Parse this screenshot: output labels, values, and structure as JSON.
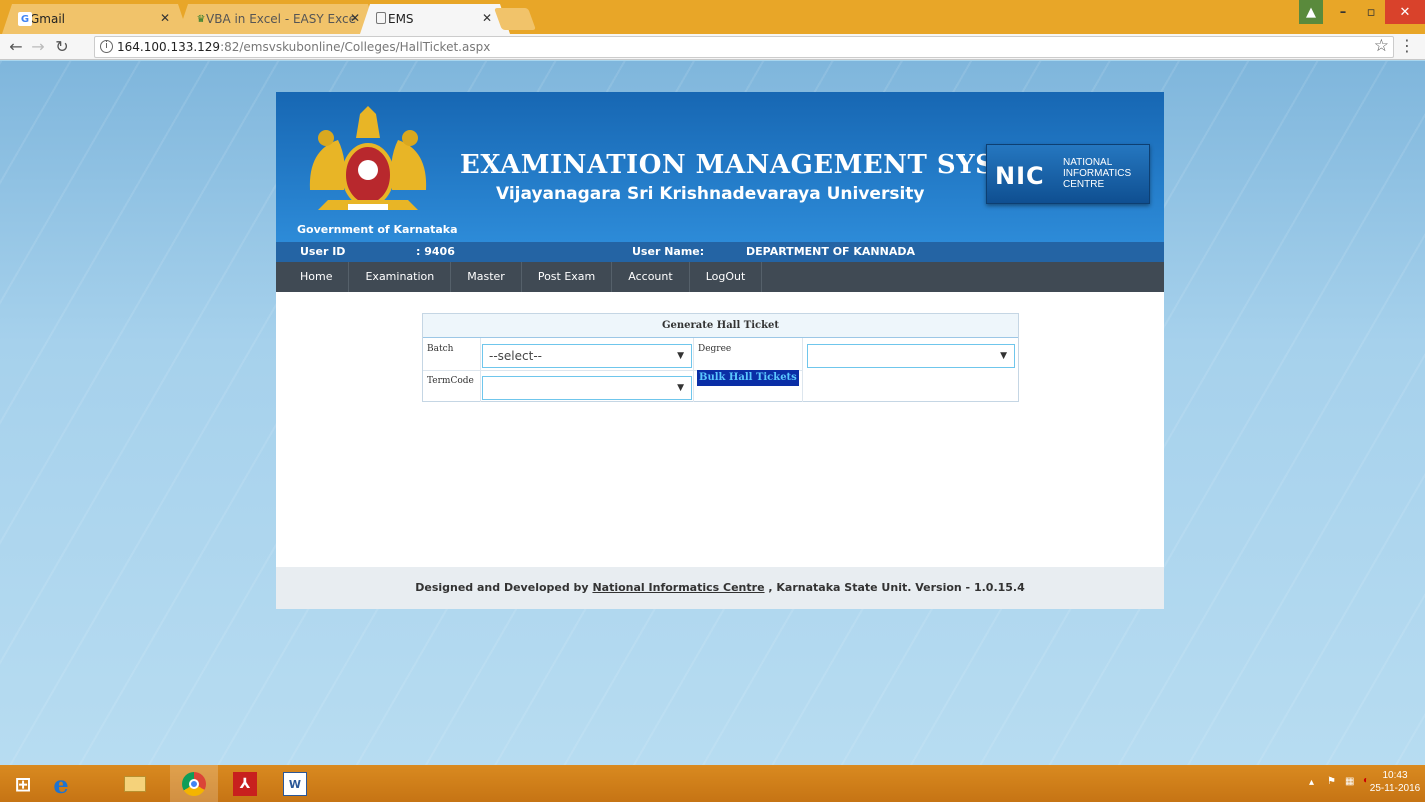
{
  "browser": {
    "tabs": [
      {
        "label": "Gmail",
        "favicon": "G"
      },
      {
        "label": "VBA in Excel - EASY Exce",
        "favicon": "excel-easy-icon"
      },
      {
        "label": "EMS",
        "favicon": "page-icon"
      }
    ],
    "url_host": "164.100.133.129",
    "url_rest": ":82/emsvskubonline/Colleges/HallTicket.aspx"
  },
  "header": {
    "gov_label": "Government of Karnataka",
    "title": "EXAMINATION MANAGEMENT SYSTEM",
    "subtitle": "Vijayanagara Sri Krishnadevaraya University",
    "nic_mark": "NIC",
    "nic_line1": "NATIONAL",
    "nic_line2": "INFORMATICS",
    "nic_line3": "CENTRE"
  },
  "userbar": {
    "user_id_label": "User ID",
    "user_id_value": ": 9406",
    "user_name_label": "User Name:",
    "user_name_value": "DEPARTMENT OF KANNADA"
  },
  "nav": {
    "items": [
      "Home",
      "Examination",
      "Master",
      "Post Exam",
      "Account",
      "LogOut"
    ]
  },
  "form": {
    "title": "Generate Hall Ticket",
    "batch_label": "Batch",
    "batch_value": "--select--",
    "degree_label": "Degree",
    "degree_value": "",
    "termcode_label": "TermCode",
    "termcode_value": "",
    "bulk_button": "Bulk Hall Tickets"
  },
  "footer": {
    "prefix": "Designed and Developed by",
    "link": "National Informatics Centre",
    "suffix": ", Karnataka State Unit.  Version - 1.0.15.4"
  },
  "taskbar": {
    "time": "10:43",
    "date": "25-11-2016"
  },
  "colors": {
    "banner": "#1e73c0",
    "navbar": "#404a54",
    "taskbar": "#d08018"
  }
}
